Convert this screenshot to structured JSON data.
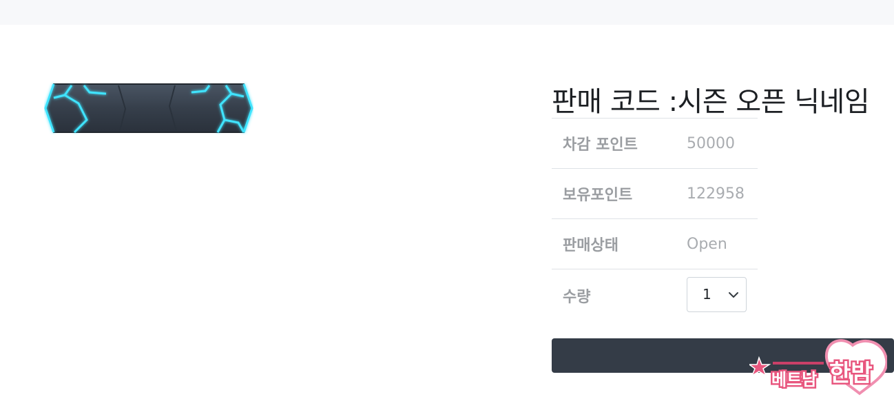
{
  "product": {
    "title": "판매 코드 :시즌 오픈 닉네임",
    "image_name": "hexagon-nameplate-banner"
  },
  "info": {
    "rows": [
      {
        "label": "차감 포인트",
        "value": "50000"
      },
      {
        "label": "보유포인트",
        "value": "122958"
      },
      {
        "label": "판매상태",
        "value": "Open"
      }
    ],
    "quantity": {
      "label": "수량",
      "selected": "1"
    }
  },
  "buy_button": {
    "label": ""
  },
  "watermark": {
    "text": "베트남 한밤"
  },
  "colors": {
    "top_bar": "#f7f8fa",
    "button_bg": "#343c47",
    "title": "#1c1f23",
    "label": "#9a9da1",
    "value": "#a9acb0",
    "accent_cyan": "#3fe4ff",
    "watermark_pink": "#e8567e"
  }
}
